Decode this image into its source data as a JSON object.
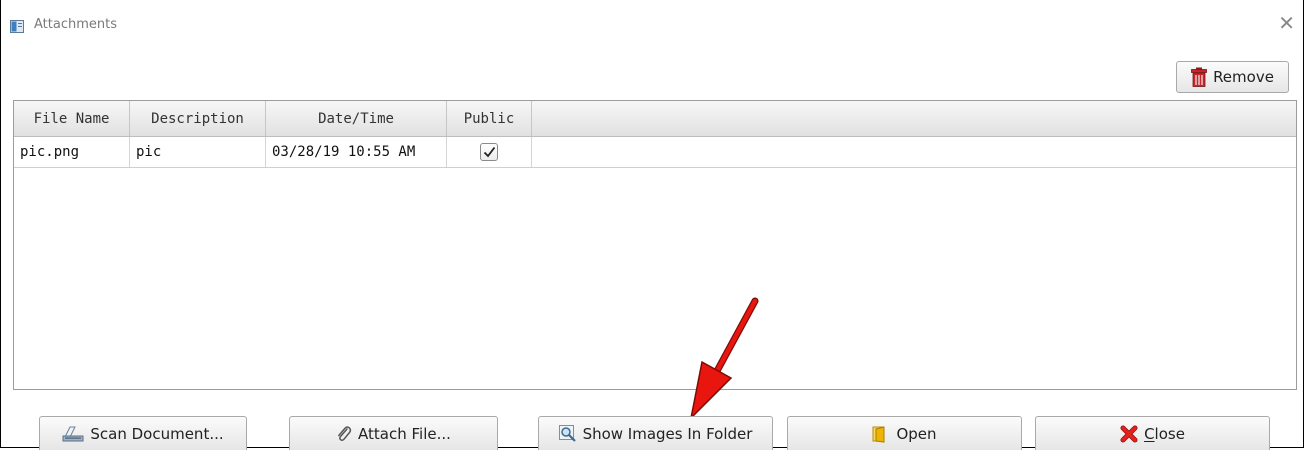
{
  "window": {
    "title": "Attachments",
    "close_glyph": "✕"
  },
  "toolbar": {
    "remove_label": "Remove",
    "remove_icon": "trash-icon",
    "remove_color": "#c0282d"
  },
  "table": {
    "columns": [
      "File Name",
      "Description",
      "Date/Time",
      "Public"
    ],
    "rows": [
      {
        "file_name": "pic.png",
        "description": "pic",
        "date_time": "03/28/19 10:55 AM",
        "public": true
      }
    ]
  },
  "annotation": {
    "arrow_color": "#e8160f",
    "points_to": "show-images-in-folder-button"
  },
  "footer": {
    "scan_label": "Scan Document...",
    "attach_label": "Attach File...",
    "show_images_label": "Show Images In Folder",
    "open_label": "Open",
    "close_label": "Close",
    "close_icon_color": "#e5221a",
    "open_icon_color": "#f0b400"
  }
}
